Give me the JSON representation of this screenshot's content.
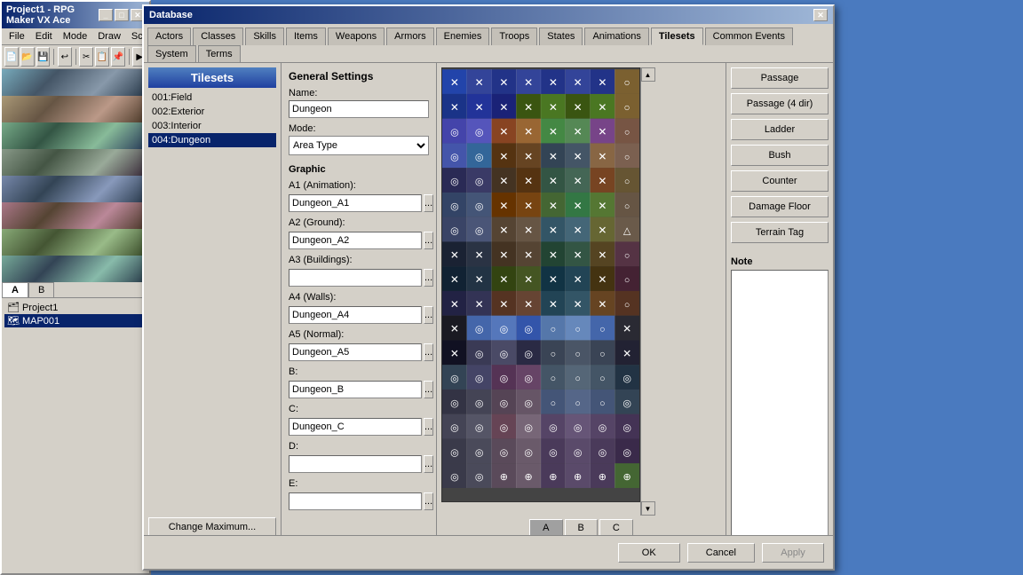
{
  "rpg_window": {
    "title": "Project1 - RPG Maker VX Ace",
    "menus": [
      "File",
      "Edit",
      "Mode",
      "Draw",
      "Scale"
    ],
    "tabs": [
      "A",
      "B"
    ],
    "project_name": "Project1",
    "map_name": "MAP001"
  },
  "database": {
    "title": "Database",
    "tabs": [
      "Actors",
      "Classes",
      "Skills",
      "Items",
      "Weapons",
      "Armors",
      "Enemies",
      "Troops",
      "States",
      "Animations",
      "Tilesets",
      "Common Events",
      "System",
      "Terms"
    ],
    "active_tab": "Tilesets",
    "list_title": "Tilesets",
    "list_items": [
      "001:Field",
      "002:Exterior",
      "003:Interior",
      "004:Dungeon"
    ],
    "selected_item": "004:Dungeon",
    "change_max_label": "Change Maximum...",
    "general_settings": {
      "title": "General Settings",
      "name_label": "Name:",
      "name_value": "Dungeon",
      "mode_label": "Mode:",
      "mode_value": "Area Type"
    },
    "graphic": {
      "title": "Graphic",
      "a1_label": "A1 (Animation):",
      "a1_value": "Dungeon_A1",
      "a2_label": "A2 (Ground):",
      "a2_value": "Dungeon_A2",
      "a3_label": "A3 (Buildings):",
      "a3_value": "",
      "a4_label": "A4 (Walls):",
      "a4_value": "Dungeon_A4",
      "a5_label": "A5 (Normal):",
      "a5_value": "Dungeon_A5",
      "b_label": "B:",
      "b_value": "Dungeon_B",
      "c_label": "C:",
      "c_value": "Dungeon_C",
      "d_label": "D:",
      "d_value": "",
      "e_label": "E:",
      "e_value": ""
    },
    "buttons": {
      "passage": "Passage",
      "passage4dir": "Passage (4 dir)",
      "ladder": "Ladder",
      "bush": "Bush",
      "counter": "Counter",
      "damage_floor": "Damage Floor",
      "terrain_tag": "Terrain Tag"
    },
    "note_label": "Note",
    "tile_tabs": [
      "A",
      "B",
      "C"
    ],
    "active_tile_tab": "A",
    "footer": {
      "ok": "OK",
      "cancel": "Cancel",
      "apply": "Apply"
    }
  }
}
